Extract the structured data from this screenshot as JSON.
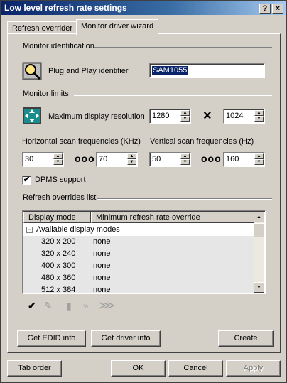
{
  "window": {
    "title": "Low level refresh rate settings",
    "help_button": "?",
    "close_button": "×"
  },
  "tabs": [
    {
      "label": "Refresh overrider"
    },
    {
      "label": "Monitor driver wizard"
    }
  ],
  "monitor_identification": {
    "group_label": "Monitor identification",
    "pnp_label": "Plug and Play identifier",
    "pnp_value": "SAM1055",
    "icon": "magnifier-monitor-icon"
  },
  "monitor_limits": {
    "group_label": "Monitor limits",
    "max_res_label": "Maximum display resolution",
    "max_res_width": "1280",
    "max_res_height": "1024",
    "times_symbol": "×",
    "horiz_label": "Horizontal scan frequencies (KHz)",
    "horiz_min": "30",
    "horiz_max": "70",
    "vert_label": "Vertical scan frequencies (Hz)",
    "vert_min": "50",
    "vert_max": "160",
    "range_dots": "ooo",
    "dpms_label": "DPMS support",
    "dpms_checked": true
  },
  "refresh_overrides": {
    "group_label": "Refresh overrides list",
    "columns": [
      "Display mode",
      "Minimum refresh rate override"
    ],
    "tree_root": "Available display modes",
    "rows": [
      {
        "mode": "320 x 200",
        "override": "none"
      },
      {
        "mode": "320 x 240",
        "override": "none"
      },
      {
        "mode": "400 x 300",
        "override": "none"
      },
      {
        "mode": "480 x 360",
        "override": "none"
      },
      {
        "mode": "512 x 384",
        "override": "none"
      }
    ]
  },
  "buttons": {
    "get_edid": "Get EDID info",
    "get_driver": "Get driver info",
    "create": "Create",
    "tab_order": "Tab order",
    "ok": "OK",
    "cancel": "Cancel",
    "apply": "Apply"
  }
}
